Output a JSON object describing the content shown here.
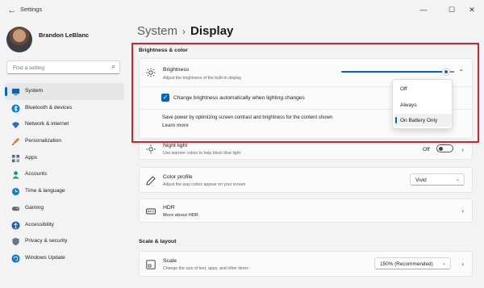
{
  "app": {
    "title": "Settings",
    "back_icon": "back-arrow-icon"
  },
  "window_controls": {
    "minimize": "—",
    "maximize": "☐",
    "close": "✕"
  },
  "profile": {
    "name": "Brandon LeBlanc"
  },
  "search": {
    "placeholder": "Find a setting",
    "icon": "search-icon"
  },
  "sidebar": {
    "items": [
      {
        "label": "System",
        "icon": "system-icon",
        "color": "#0067c0"
      },
      {
        "label": "Bluetooth & devices",
        "icon": "bluetooth-icon",
        "color": "#0a7cd6"
      },
      {
        "label": "Network & internet",
        "icon": "wifi-icon",
        "color": "#2a6ec1"
      },
      {
        "label": "Personalization",
        "icon": "brush-icon",
        "color": "#d6793a"
      },
      {
        "label": "Apps",
        "icon": "apps-icon",
        "color": "#5a6a80"
      },
      {
        "label": "Accounts",
        "icon": "person-icon",
        "color": "#1aa05a"
      },
      {
        "label": "Time & language",
        "icon": "globe-clock-icon",
        "color": "#1b7fc7"
      },
      {
        "label": "Gaming",
        "icon": "controller-icon",
        "color": "#6b6b6b"
      },
      {
        "label": "Accessibility",
        "icon": "accessibility-icon",
        "color": "#1f5fb0"
      },
      {
        "label": "Privacy & security",
        "icon": "shield-icon",
        "color": "#6d7680"
      },
      {
        "label": "Windows Update",
        "icon": "update-icon",
        "color": "#0a7cd6"
      }
    ]
  },
  "breadcrumb": {
    "parent": "System",
    "separator": "›",
    "current": "Display"
  },
  "sections": {
    "brightness_color": "Brightness & color",
    "scale_layout": "Scale & layout"
  },
  "brightness": {
    "title": "Brightness",
    "subtitle": "Adjust the brightness of the built-in display",
    "level": 0.95,
    "auto_checkbox": {
      "label": "Change brightness automatically when lighting changes",
      "checked": true
    },
    "content_adaptive": {
      "label": "Save power by optimizing screen contrast and brightness for the content shown",
      "link": "Learn more"
    },
    "dropdown": {
      "options": [
        "Off",
        "Always",
        "On Battery Only"
      ],
      "selected": "On Battery Only"
    }
  },
  "night_light": {
    "title": "Night light",
    "subtitle": "Use warmer colors to help block blue light",
    "state": "Off"
  },
  "color_profile": {
    "title": "Color profile",
    "subtitle": "Adjust the way colors appear on your screen",
    "value": "Vivid"
  },
  "hdr": {
    "title": "HDR",
    "link": "More about HDR"
  },
  "scale": {
    "title": "Scale",
    "subtitle": "Change the size of text, apps, and other items",
    "value": "150% (Recommended)"
  },
  "colors": {
    "accent": "#0067c0",
    "highlight_border": "#d1242a"
  }
}
